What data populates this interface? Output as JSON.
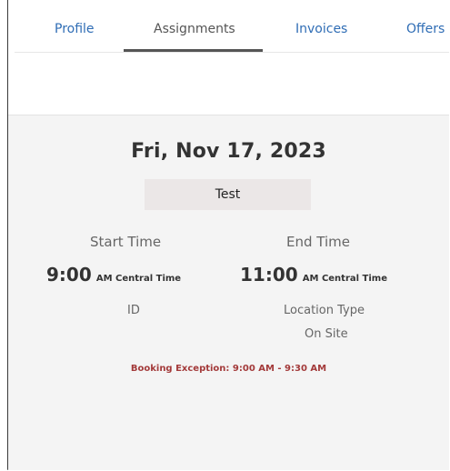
{
  "tabs": [
    {
      "label": "Profile"
    },
    {
      "label": "Assignments"
    },
    {
      "label": "Invoices"
    },
    {
      "label": "Offers"
    }
  ],
  "assignment": {
    "date": "Fri, Nov 17, 2023",
    "name": "Test",
    "start_label": "Start Time",
    "start_time": "9:00",
    "start_suffix": "AM Central Time",
    "end_label": "End Time",
    "end_time": "11:00",
    "end_suffix": "AM Central Time",
    "id_label": "ID",
    "location_type_label": "Location Type",
    "location_type_value": "On Site",
    "booking_exception": "Booking Exception: 9:00 AM - 9:30 AM"
  },
  "colors": {
    "link": "#2f6db5",
    "active_tab": "#555555",
    "panel_bg": "#f4f4f4",
    "exception": "#a33a3a"
  }
}
